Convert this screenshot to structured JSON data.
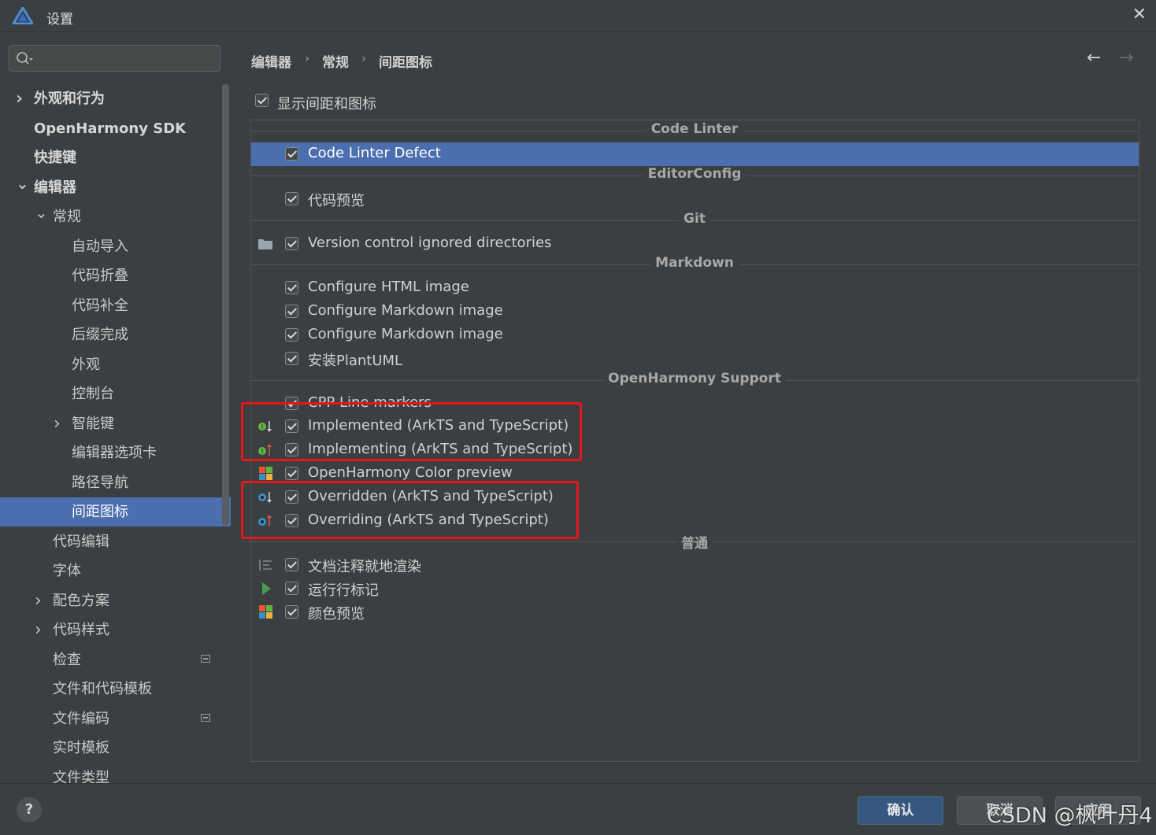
{
  "window": {
    "title": "设置",
    "close_glyph": "✕"
  },
  "search": {
    "value": "",
    "placeholder": ""
  },
  "sidebar": {
    "items": [
      {
        "label": "外观和行为",
        "bold": true,
        "expander": "collapsed",
        "indent": 0
      },
      {
        "label": "OpenHarmony SDK",
        "bold": true,
        "expander": "none",
        "indent": 0
      },
      {
        "label": "快捷键",
        "bold": true,
        "expander": "none",
        "indent": 0
      },
      {
        "label": "编辑器",
        "bold": true,
        "expander": "expanded",
        "indent": 0
      },
      {
        "label": "常规",
        "bold": false,
        "expander": "expanded",
        "indent": 1
      },
      {
        "label": "自动导入",
        "bold": false,
        "expander": "none",
        "indent": 2
      },
      {
        "label": "代码折叠",
        "bold": false,
        "expander": "none",
        "indent": 2
      },
      {
        "label": "代码补全",
        "bold": false,
        "expander": "none",
        "indent": 2
      },
      {
        "label": "后缀完成",
        "bold": false,
        "expander": "none",
        "indent": 2
      },
      {
        "label": "外观",
        "bold": false,
        "expander": "none",
        "indent": 2
      },
      {
        "label": "控制台",
        "bold": false,
        "expander": "none",
        "indent": 2
      },
      {
        "label": "智能键",
        "bold": false,
        "expander": "collapsed",
        "indent": 2
      },
      {
        "label": "编辑器选项卡",
        "bold": false,
        "expander": "none",
        "indent": 2
      },
      {
        "label": "路径导航",
        "bold": false,
        "expander": "none",
        "indent": 2
      },
      {
        "label": "间距图标",
        "bold": false,
        "expander": "none",
        "indent": 2,
        "selected": true
      },
      {
        "label": "代码编辑",
        "bold": false,
        "expander": "none",
        "indent": 1
      },
      {
        "label": "字体",
        "bold": false,
        "expander": "none",
        "indent": 1
      },
      {
        "label": "配色方案",
        "bold": false,
        "expander": "collapsed",
        "indent": 1
      },
      {
        "label": "代码样式",
        "bold": false,
        "expander": "collapsed",
        "indent": 1
      },
      {
        "label": "检查",
        "bold": false,
        "expander": "none",
        "indent": 1,
        "badge": true
      },
      {
        "label": "文件和代码模板",
        "bold": false,
        "expander": "none",
        "indent": 1
      },
      {
        "label": "文件编码",
        "bold": false,
        "expander": "none",
        "indent": 1,
        "badge": true
      },
      {
        "label": "实时模板",
        "bold": false,
        "expander": "none",
        "indent": 1
      },
      {
        "label": "文件类型",
        "bold": false,
        "expander": "none",
        "indent": 1
      }
    ]
  },
  "breadcrumb": {
    "items": [
      "编辑器",
      "常规",
      "间距图标"
    ],
    "separator": "›"
  },
  "nav": {
    "back": "←",
    "forward": "→"
  },
  "show_gutter": {
    "label": "显示间距和图标",
    "checked": true
  },
  "gutter_list": {
    "sections": [
      {
        "title": "Code Linter",
        "rows": [
          {
            "label": "Code Linter Defect",
            "checked": true,
            "icon": "",
            "selected": true
          }
        ]
      },
      {
        "title": "EditorConfig",
        "rows": [
          {
            "label": "代码预览",
            "checked": true,
            "icon": ""
          }
        ]
      },
      {
        "title": "Git",
        "rows": [
          {
            "label": "Version control ignored directories",
            "checked": true,
            "icon": "folder-icon"
          }
        ]
      },
      {
        "title": "Markdown",
        "rows": [
          {
            "label": "Configure HTML image",
            "checked": true,
            "icon": ""
          },
          {
            "label": "Configure Markdown image",
            "checked": true,
            "icon": ""
          },
          {
            "label": "Configure Markdown image",
            "checked": true,
            "icon": ""
          },
          {
            "label": "安装PlantUML",
            "checked": true,
            "icon": ""
          }
        ]
      },
      {
        "title": "OpenHarmony Support",
        "rows": [
          {
            "label": "CPP Line markers",
            "checked": true,
            "icon": ""
          },
          {
            "label": "Implemented (ArkTS and TypeScript)",
            "checked": true,
            "icon": "implemented-icon"
          },
          {
            "label": "Implementing (ArkTS and TypeScript)",
            "checked": true,
            "icon": "implementing-icon"
          },
          {
            "label": "OpenHarmony Color preview",
            "checked": true,
            "icon": "color-grid-icon"
          },
          {
            "label": "Overridden (ArkTS and TypeScript)",
            "checked": true,
            "icon": "overridden-icon"
          },
          {
            "label": "Overriding (ArkTS and TypeScript)",
            "checked": true,
            "icon": "overriding-icon"
          }
        ]
      },
      {
        "title": "普通",
        "rows": [
          {
            "label": "文档注释就地渲染",
            "checked": true,
            "icon": "doc-lines-icon"
          },
          {
            "label": "运行行标记",
            "checked": true,
            "icon": "run-icon"
          },
          {
            "label": "颜色预览",
            "checked": true,
            "icon": "color-grid-icon"
          }
        ]
      }
    ]
  },
  "footer": {
    "help": "?",
    "ok_label": "确认",
    "cancel_label": "取消",
    "apply_label": "应用",
    "watermark": "CSDN @枫叶丹4"
  },
  "colors": {
    "accent": "#4b6eaf",
    "highlight_box": "#e8161b",
    "background": "#3c3f41"
  }
}
